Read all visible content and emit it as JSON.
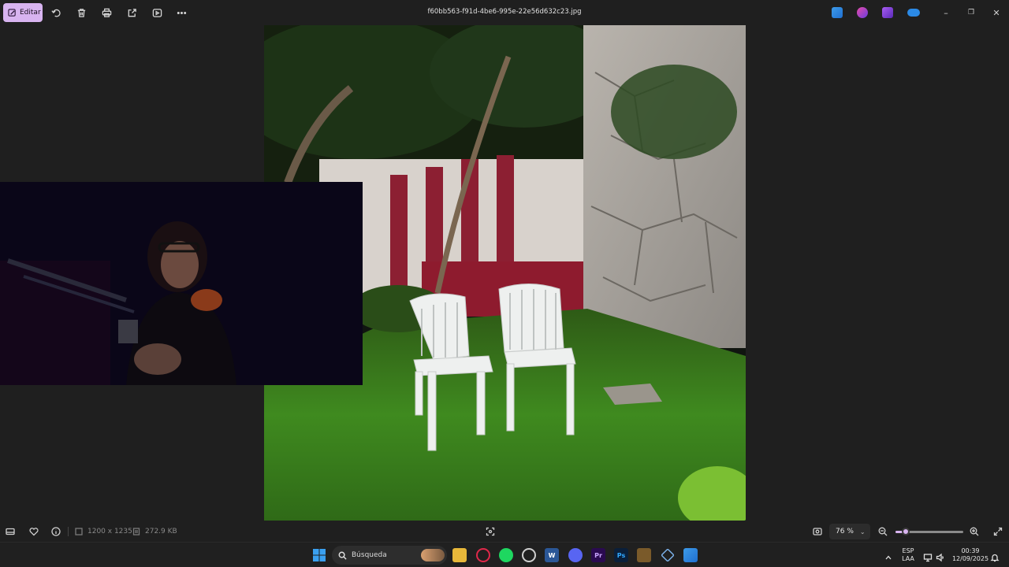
{
  "toolbar": {
    "edit_label": "Editar",
    "filename": "f60bb563-f91d-4be6-995e-22e56d632c23.jpg",
    "tools": [
      "rotate-icon",
      "delete-icon",
      "print-icon",
      "share-icon",
      "slideshow-icon",
      "more-icon"
    ],
    "accent_color": "#d8b4f0"
  },
  "status": {
    "dimensions": "1200 x 1235",
    "file_size": "272.9 KB",
    "zoom": "76 %",
    "zoom_level": 0.15
  },
  "taskbar": {
    "search_label": "Búsqueda",
    "language_top": "ESP",
    "language_bottom": "LAA",
    "time": "00:39",
    "date": "12/09/2025"
  }
}
